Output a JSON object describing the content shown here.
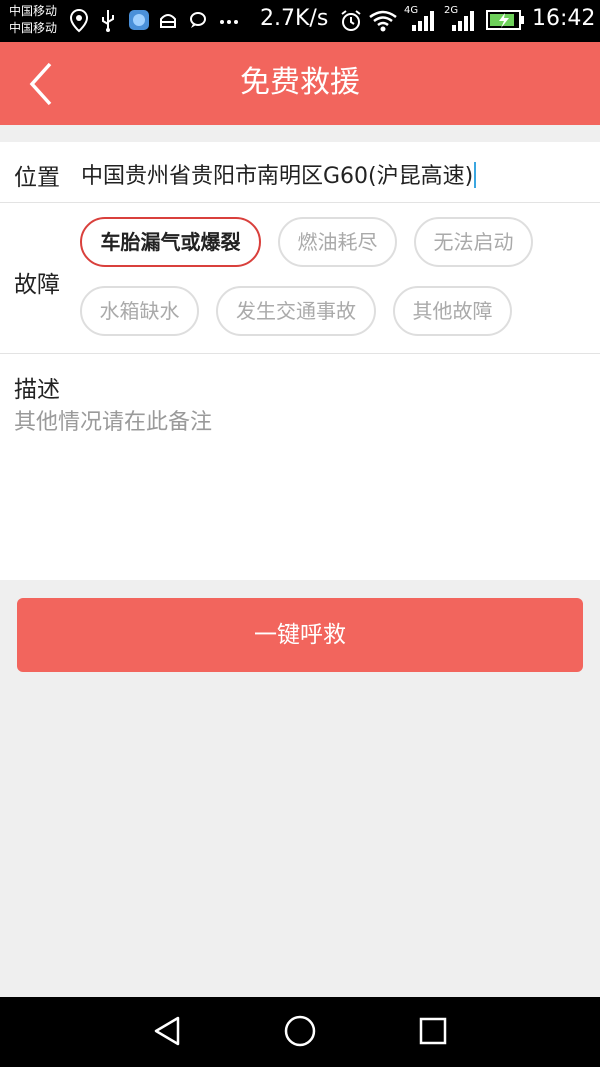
{
  "status_bar": {
    "carrier_1": "中国移动",
    "carrier_2": "中国移动",
    "net_speed": "2.7K/s",
    "network_1": "4G",
    "network_2": "2G",
    "time": "16:42",
    "icons": [
      "location-icon",
      "usb-icon",
      "app-icon",
      "android-icon",
      "chat-icon",
      "more-icon",
      "alarm-icon",
      "wifi-icon",
      "signal-icon",
      "battery-icon"
    ]
  },
  "header": {
    "title": "免费救援",
    "back_icon": "chevron-left-icon"
  },
  "form": {
    "location_label": "位置",
    "location_value": "中国贵州省贵阳市南明区G60(沪昆高速)",
    "fault_label": "故障",
    "fault_options": [
      {
        "label": "车胎漏气或爆裂",
        "selected": true
      },
      {
        "label": "燃油耗尽",
        "selected": false
      },
      {
        "label": "无法启动",
        "selected": false
      },
      {
        "label": "水箱缺水",
        "selected": false
      },
      {
        "label": "发生交通事故",
        "selected": false
      },
      {
        "label": "其他故障",
        "selected": false
      }
    ],
    "description_label": "描述",
    "description_placeholder": "其他情况请在此备注"
  },
  "actions": {
    "sos_button": "一键呼救"
  },
  "colors": {
    "accent": "#f2655d",
    "selected_border": "#d9403c",
    "background": "#efefef"
  },
  "nav_bar": {
    "icons": [
      "back-triangle-icon",
      "home-circle-icon",
      "recents-square-icon"
    ]
  }
}
